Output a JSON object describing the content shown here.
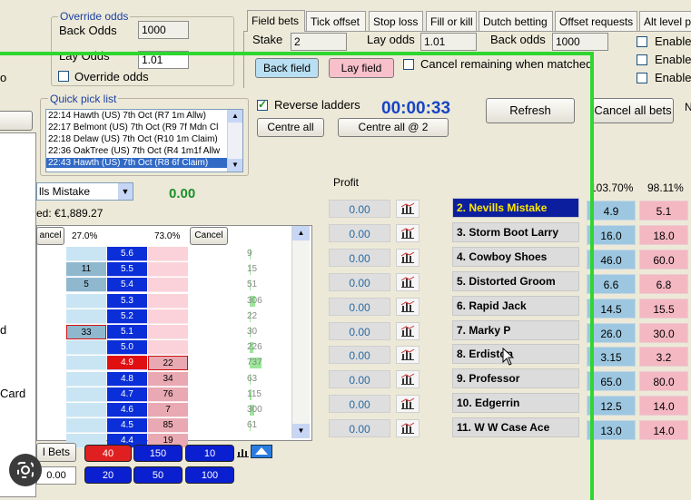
{
  "override": {
    "title": "Override odds",
    "back_label": "Back Odds",
    "back_value": "1000",
    "lay_label": "Lay Odds",
    "lay_value": "1.01",
    "checkbox_label": "Override odds",
    "left_cut_label": "o"
  },
  "tabs": [
    "Field bets",
    "Tick offset",
    "Stop loss",
    "Fill or kill",
    "Dutch betting",
    "Offset requests",
    "Alt level p"
  ],
  "field_bets": {
    "stake_label": "Stake",
    "stake_value": "2",
    "lay_odds_label": "Lay odds",
    "lay_odds_value": "1.01",
    "back_odds_label": "Back odds",
    "back_odds_value": "1000",
    "back_field": "Back field",
    "lay_field": "Lay field",
    "cancel_remaining": "Cancel remaining when matched",
    "enable": [
      "Enable",
      "Enable",
      "Enable"
    ]
  },
  "quick_pick": {
    "title": "Quick pick list",
    "items": [
      "22:14 Hawth (US) 7th Oct (R7 1m Allw)",
      "22:17 Belmont (US) 7th Oct (R9 7f Mdn Cl",
      "22:18 Delaw (US) 7th Oct (R10 1m Claim)",
      "22:36 OakTree (US) 7th Oct (R4 1m1f Allw",
      "22:43 Hawth (US) 7th Oct (R8 6f Claim)"
    ],
    "selected_index": 4
  },
  "controls": {
    "reverse_ladders": "Reverse ladders",
    "timer": "00:00:33",
    "refresh": "Refresh",
    "cancel_all_bets": "Cancel all bets",
    "centre_all": "Centre all",
    "centre_all_at": "Centre all @ 2",
    "right_cut": "N"
  },
  "ladder": {
    "runner_select": "lls Mistake",
    "pl_value": "0.00",
    "matched_label": "ed: €1,889.27",
    "cancel_left": "ancel",
    "back_pct": "27.0%",
    "lay_pct": "73.0%",
    "cancel_right": "Cancel",
    "rows": [
      {
        "price": "5.6",
        "back": "",
        "lay": "",
        "vol": "9"
      },
      {
        "price": "5.5",
        "back": "11",
        "lay": "",
        "vol": "15"
      },
      {
        "price": "5.4",
        "back": "5",
        "lay": "",
        "vol": "51"
      },
      {
        "price": "5.3",
        "back": "",
        "lay": "",
        "vol": "306"
      },
      {
        "price": "5.2",
        "back": "",
        "lay": "",
        "vol": "22"
      },
      {
        "price": "5.1",
        "back": "33",
        "lay": "",
        "vol": "30"
      },
      {
        "price": "5.0",
        "back": "",
        "lay": "",
        "vol": "226"
      },
      {
        "price": "4.9",
        "back": "",
        "lay": "22",
        "vol": "737"
      },
      {
        "price": "4.8",
        "back": "",
        "lay": "34",
        "vol": "63"
      },
      {
        "price": "4.7",
        "back": "",
        "lay": "76",
        "vol": "115"
      },
      {
        "price": "4.6",
        "back": "",
        "lay": "7",
        "vol": "300"
      },
      {
        "price": "4.5",
        "back": "",
        "lay": "85",
        "vol": "61"
      },
      {
        "price": "4.4",
        "back": "",
        "lay": "19",
        "vol": ""
      }
    ]
  },
  "left_labels": [
    "d",
    "Card"
  ],
  "bets_button": "l Bets",
  "bets_value": "0.00",
  "stakes_red": [
    "40",
    "150",
    "10"
  ],
  "stakes_blue": [
    "20",
    "50",
    "100"
  ],
  "market": {
    "profit_header": "Profit",
    "back_book": "103.70%",
    "lay_book": "98.11%",
    "runners": [
      {
        "name": "2. Nevills Mistake",
        "profit": "0.00",
        "back": "4.9",
        "lay": "5.1",
        "selected": true
      },
      {
        "name": "3. Storm Boot Larry",
        "profit": "0.00",
        "back": "16.0",
        "lay": "18.0"
      },
      {
        "name": "4. Cowboy Shoes",
        "profit": "0.00",
        "back": "46.0",
        "lay": "60.0"
      },
      {
        "name": "5. Distorted Groom",
        "profit": "0.00",
        "back": "6.6",
        "lay": "6.8"
      },
      {
        "name": "6. Rapid Jack",
        "profit": "0.00",
        "back": "14.5",
        "lay": "15.5"
      },
      {
        "name": "7. Marky P",
        "profit": "0.00",
        "back": "26.0",
        "lay": "30.0"
      },
      {
        "name": "8. Erdiston",
        "profit": "0.00",
        "back": "3.15",
        "lay": "3.2"
      },
      {
        "name": "9. Professor",
        "profit": "0.00",
        "back": "65.0",
        "lay": "80.0"
      },
      {
        "name": "10. Edgerrin",
        "profit": "0.00",
        "back": "12.5",
        "lay": "14.0"
      },
      {
        "name": "11. W W Case Ace",
        "profit": "0.00",
        "back": "13.0",
        "lay": "14.0"
      }
    ]
  },
  "colors": {
    "highlight_border": "#2fd62f",
    "ladder_price": "#0a2ed8",
    "ladder_price_current": "#e01010",
    "back": "#9dc7e0",
    "lay": "#f4b8c2",
    "selected_runner": "#0b1f9e"
  }
}
